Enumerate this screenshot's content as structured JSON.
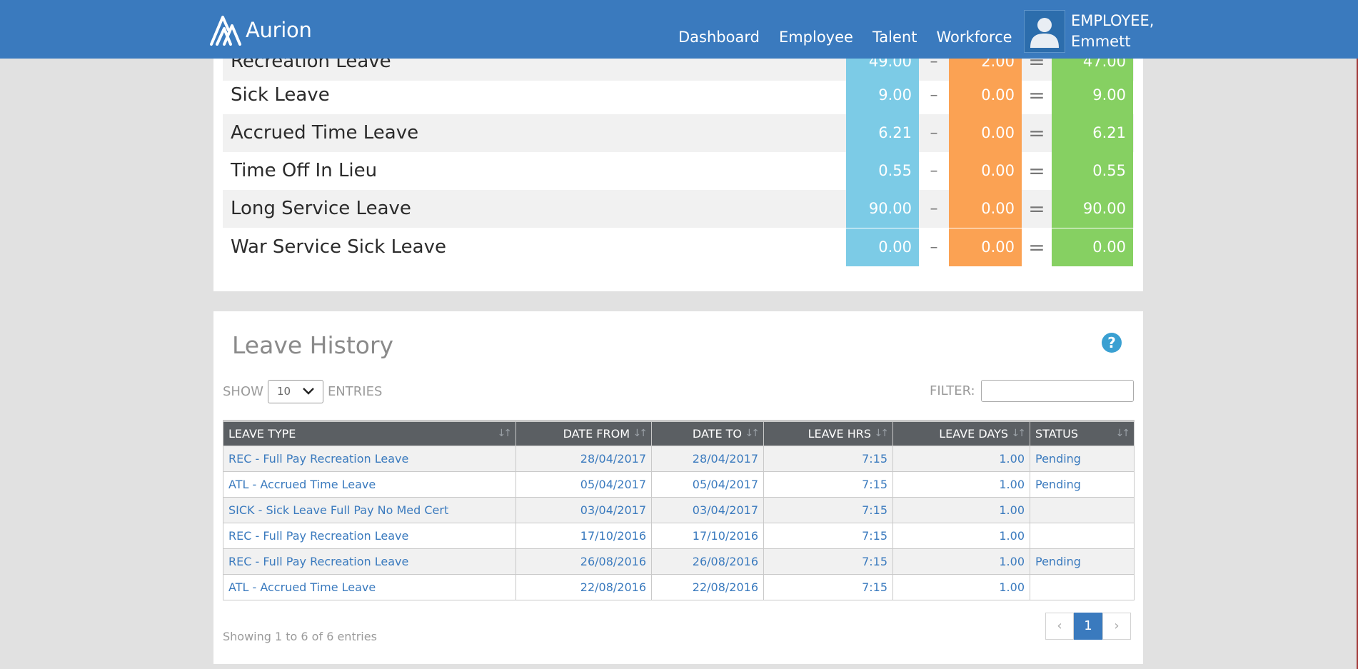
{
  "brand": {
    "name": "Aurion"
  },
  "nav": {
    "items": [
      {
        "label": "Dashboard"
      },
      {
        "label": "Employee"
      },
      {
        "label": "Talent"
      },
      {
        "label": "Workforce"
      }
    ]
  },
  "user": {
    "line1": "EMPLOYEE,",
    "line2": "Emmett"
  },
  "balances": {
    "operators": {
      "minus": "–",
      "equal": "="
    },
    "rows": [
      {
        "label": "Recreation Leave",
        "available": "49.00",
        "taken": "2.00",
        "balance": "47.00"
      },
      {
        "label": "Sick Leave",
        "available": "9.00",
        "taken": "0.00",
        "balance": "9.00"
      },
      {
        "label": "Accrued Time Leave",
        "available": "6.21",
        "taken": "0.00",
        "balance": "6.21"
      },
      {
        "label": "Time Off In Lieu",
        "available": "0.55",
        "taken": "0.00",
        "balance": "0.55"
      },
      {
        "label": "Long Service Leave",
        "available": "90.00",
        "taken": "0.00",
        "balance": "90.00"
      },
      {
        "label": "War Service Sick Leave",
        "available": "0.00",
        "taken": "0.00",
        "balance": "0.00"
      }
    ],
    "colors": {
      "available": "#7ccbe6",
      "taken": "#fba253",
      "balance": "#86d062"
    }
  },
  "history": {
    "title": "Leave History",
    "help": "?",
    "show_label": "SHOW",
    "entries_value": "10",
    "entries_label": "ENTRIES",
    "filter_label": "FILTER:",
    "filter_value": "",
    "columns": [
      "LEAVE TYPE",
      "DATE FROM",
      "DATE TO",
      "LEAVE HRS",
      "LEAVE DAYS",
      "STATUS"
    ],
    "rows": [
      {
        "type": "REC - Full Pay Recreation Leave",
        "from": "28/04/2017",
        "to": "28/04/2017",
        "hrs": "7:15",
        "days": "1.00",
        "status": "Pending"
      },
      {
        "type": "ATL - Accrued Time Leave",
        "from": "05/04/2017",
        "to": "05/04/2017",
        "hrs": "7:15",
        "days": "1.00",
        "status": "Pending"
      },
      {
        "type": "SICK - Sick Leave Full Pay No Med Cert",
        "from": "03/04/2017",
        "to": "03/04/2017",
        "hrs": "7:15",
        "days": "1.00",
        "status": ""
      },
      {
        "type": "REC - Full Pay Recreation Leave",
        "from": "17/10/2016",
        "to": "17/10/2016",
        "hrs": "7:15",
        "days": "1.00",
        "status": ""
      },
      {
        "type": "REC - Full Pay Recreation Leave",
        "from": "26/08/2016",
        "to": "26/08/2016",
        "hrs": "7:15",
        "days": "1.00",
        "status": "Pending"
      },
      {
        "type": "ATL - Accrued Time Leave",
        "from": "22/08/2016",
        "to": "22/08/2016",
        "hrs": "7:15",
        "days": "1.00",
        "status": ""
      }
    ],
    "showing": "Showing 1 to 6 of 6 entries",
    "pager": {
      "prev": "‹",
      "page": "1",
      "next": "›"
    }
  },
  "colors": {
    "brand": "#3a7abe",
    "header_row": "#5b5f63",
    "link": "#3a7abe"
  }
}
